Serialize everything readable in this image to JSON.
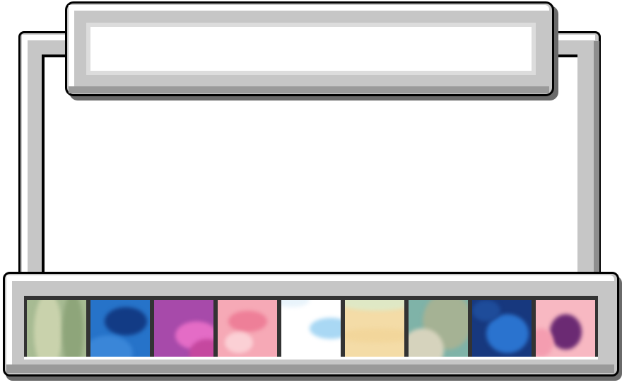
{
  "window": {
    "title": ""
  },
  "tray": {
    "thumbnails": [
      {
        "name": "thumbnail-green-stripes",
        "base": "#a7bb93",
        "accent": "#c9d2ac",
        "accent2": "#8ea57a"
      },
      {
        "name": "thumbnail-blue-camo",
        "base": "#2673c9",
        "accent": "#123b85",
        "accent2": "#3a86d8"
      },
      {
        "name": "thumbnail-purple-pink",
        "base": "#a74aaa",
        "accent": "#e46cc6",
        "accent2": "#c5489f"
      },
      {
        "name": "thumbnail-pink-clouds",
        "base": "#f6a9b6",
        "accent": "#ee7f98",
        "accent2": "#fbd0d5"
      },
      {
        "name": "thumbnail-sky-white",
        "base": "#ffffff",
        "accent": "#a9d8f4",
        "accent2": "#e9f4fb"
      },
      {
        "name": "thumbnail-sand-stripes",
        "base": "#f4dca7",
        "accent": "#f2d69b",
        "accent2": "#dfe8c5"
      },
      {
        "name": "thumbnail-teal-diagonal",
        "base": "#7fb3a8",
        "accent": "#a5b294",
        "accent2": "#d6d3bd"
      },
      {
        "name": "thumbnail-navy-blue",
        "base": "#17387e",
        "accent": "#2a73cf",
        "accent2": "#1e4c9a"
      },
      {
        "name": "thumbnail-pink-swirl",
        "base": "#f8b8c2",
        "accent": "#6b2a73",
        "accent2": "#f49db0"
      }
    ]
  }
}
